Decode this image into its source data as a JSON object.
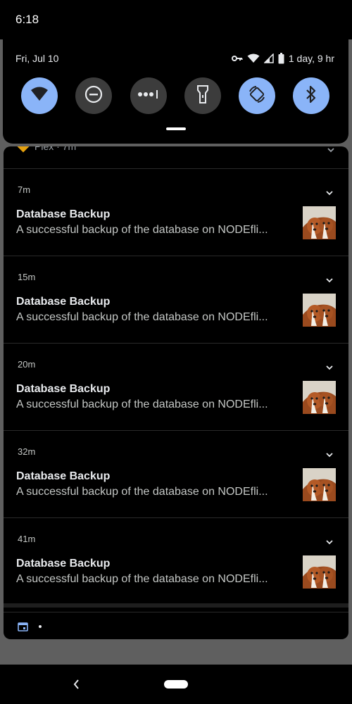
{
  "status_bar": {
    "time": "6:18"
  },
  "quick_settings": {
    "date": "Fri, Jul 10",
    "battery_text": "1 day, 9 hr",
    "tiles": [
      {
        "name": "wifi",
        "active": true
      },
      {
        "name": "do-not-disturb",
        "active": false
      },
      {
        "name": "more",
        "active": false
      },
      {
        "name": "flashlight",
        "active": false
      },
      {
        "name": "auto-rotate",
        "active": true
      },
      {
        "name": "bluetooth",
        "active": true
      }
    ]
  },
  "peek_notification": {
    "text": "Plex · 7m"
  },
  "notifications": [
    {
      "time": "7m",
      "title": "Database Backup",
      "text": "A successful backup of the database on NODEfli..."
    },
    {
      "time": "15m",
      "title": "Database Backup",
      "text": "A successful backup of the database on NODEfli..."
    },
    {
      "time": "20m",
      "title": "Database Backup",
      "text": "A successful backup of the database on NODEfli..."
    },
    {
      "time": "32m",
      "title": "Database Backup",
      "text": "A successful backup of the database on NODEfli..."
    },
    {
      "time": "41m",
      "title": "Database Backup",
      "text": "A successful backup of the database on NODEfli..."
    }
  ],
  "colors": {
    "accent": "#8ab4f8",
    "tile_off": "#3c3c3c",
    "panel": "#000000",
    "scrim": "#5f5f5f"
  }
}
